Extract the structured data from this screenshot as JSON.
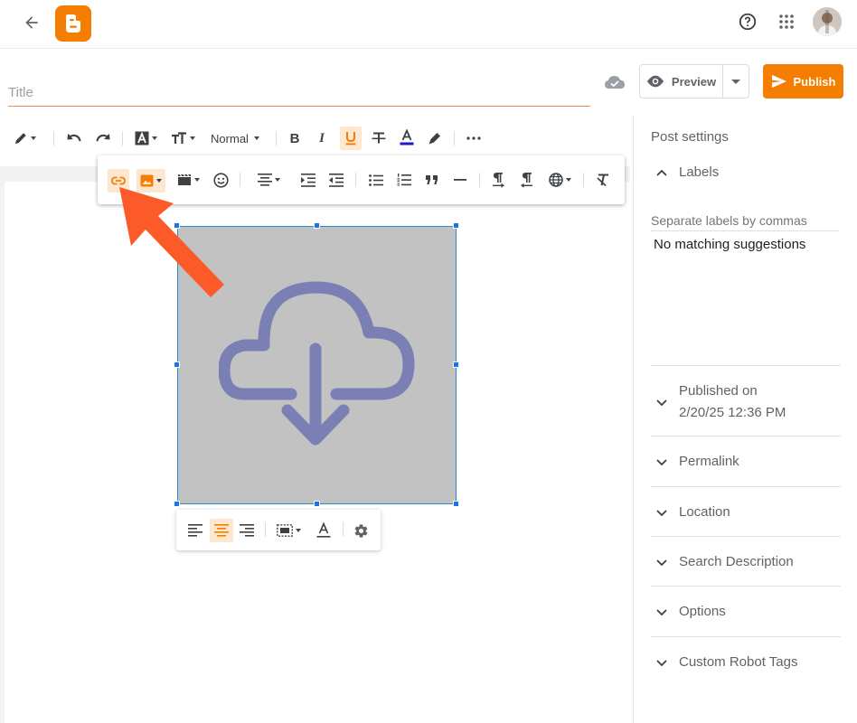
{
  "header": {
    "back_icon": "arrow-left-icon",
    "logo": "blogger-logo",
    "help_icon": "help-circle-icon",
    "apps_icon": "apps-grid-icon",
    "avatar": "user-avatar"
  },
  "post": {
    "title_placeholder": "Title",
    "preview_label": "Preview",
    "publish_label": "Publish"
  },
  "toolbar": {
    "font_size_label": "Normal"
  },
  "sidebar": {
    "heading": "Post settings",
    "labels_section": "Labels",
    "labels_placeholder": "Separate labels by commas",
    "labels_suggestions": "No matching suggestions",
    "published_on_label": "Published on",
    "published_on_value": "2/20/25 12:36 PM",
    "permalink": "Permalink",
    "location": "Location",
    "search_description": "Search Description",
    "options": "Options",
    "custom_robot_tags": "Custom Robot Tags"
  },
  "colors": {
    "accent": "#f57d00",
    "highlight": "#fde7cf",
    "arrow": "#fc5b29",
    "selection": "#1a73e8",
    "image_placeholder_bg": "#c2c2c2",
    "image_placeholder_icon": "#7a80b3"
  }
}
